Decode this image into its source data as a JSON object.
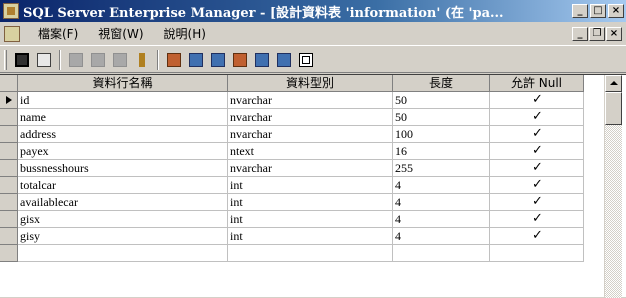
{
  "window": {
    "title": "SQL Server Enterprise Manager - [設計資料表 'information' (在 'pa...",
    "min_label": "_",
    "max_label": "□",
    "close_label": "×"
  },
  "menubar": {
    "items": [
      "檔案(F)",
      "視窗(W)",
      "說明(H)"
    ],
    "mdi_min": "_",
    "mdi_restore": "❐",
    "mdi_close": "×"
  },
  "toolbar": {
    "icons": [
      "save-icon",
      "properties-icon",
      "cut-icon",
      "copy-icon",
      "paste-icon",
      "primary-key-icon",
      "relationships-icon",
      "indexes-icon",
      "constraints-icon",
      "triggers-icon",
      "dependencies-icon",
      "generate-script-icon",
      "grid-icon"
    ]
  },
  "grid": {
    "columns": [
      "資料行名稱",
      "資料型別",
      "長度",
      "允許 Null"
    ],
    "rows": [
      {
        "name": "id",
        "type": "nvarchar",
        "length": "50",
        "allow_null": "✓"
      },
      {
        "name": "name",
        "type": "nvarchar",
        "length": "50",
        "allow_null": "✓"
      },
      {
        "name": "address",
        "type": "nvarchar",
        "length": "100",
        "allow_null": "✓"
      },
      {
        "name": "payex",
        "type": "ntext",
        "length": "16",
        "allow_null": "✓"
      },
      {
        "name": "bussnesshours",
        "type": "nvarchar",
        "length": "255",
        "allow_null": "✓"
      },
      {
        "name": "totalcar",
        "type": "int",
        "length": "4",
        "allow_null": "✓"
      },
      {
        "name": "availablecar",
        "type": "int",
        "length": "4",
        "allow_null": "✓"
      },
      {
        "name": "gisx",
        "type": "int",
        "length": "4",
        "allow_null": "✓"
      },
      {
        "name": "gisy",
        "type": "int",
        "length": "4",
        "allow_null": "✓"
      },
      {
        "name": "",
        "type": "",
        "length": "",
        "allow_null": ""
      }
    ]
  }
}
